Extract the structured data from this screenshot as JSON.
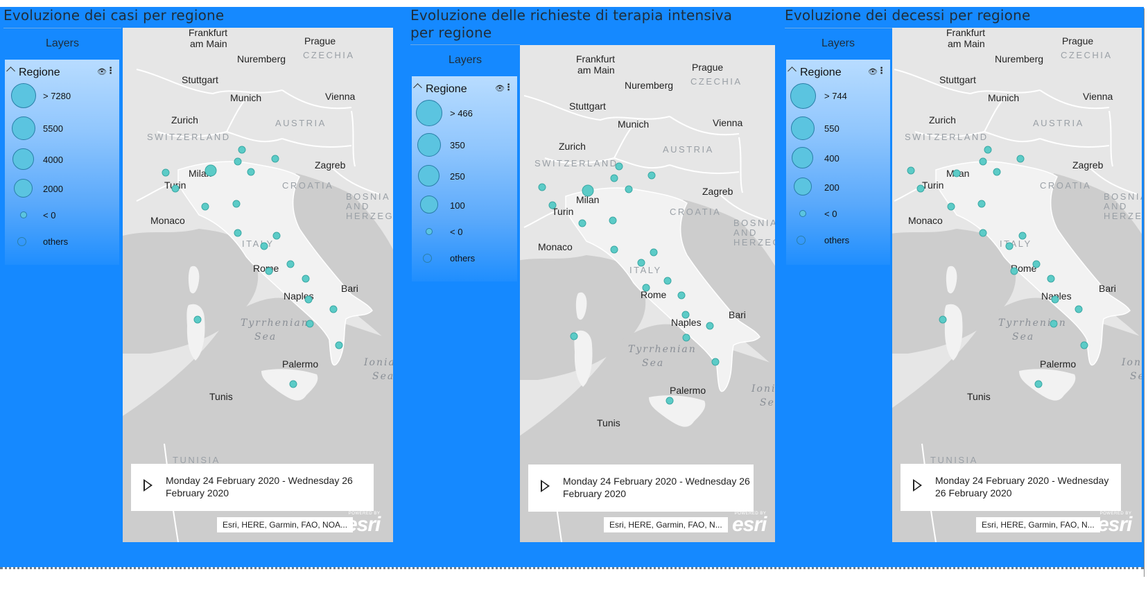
{
  "panels": [
    {
      "title": "Evoluzione dei casi per regione",
      "layers_label": "Layers",
      "legend_title": "Regione",
      "legend_items": [
        {
          "label": "> 7280",
          "marker": "circle-xl"
        },
        {
          "label": "5500",
          "marker": "circle-l"
        },
        {
          "label": "4000",
          "marker": "circle-m"
        },
        {
          "label": "2000",
          "marker": "circle-s"
        },
        {
          "label": "< 0",
          "marker": "circle-xs"
        },
        {
          "label": "others",
          "marker": "circle-hollow"
        }
      ],
      "time_range": "Monday 24 February 2020 - Wednesday 26 February 2020",
      "attribution": "Esri, HERE, Garmin, FAO, NOA...",
      "logo_powered": "POWERED BY",
      "logo_text": "esri"
    },
    {
      "title": "Evoluzione delle richieste di terapia intensiva per regione",
      "layers_label": "Layers",
      "legend_title": "Regione",
      "legend_items": [
        {
          "label": "> 466",
          "marker": "circle-xl"
        },
        {
          "label": "350",
          "marker": "circle-l"
        },
        {
          "label": "250",
          "marker": "circle-m"
        },
        {
          "label": "100",
          "marker": "circle-s"
        },
        {
          "label": "< 0",
          "marker": "circle-xs"
        },
        {
          "label": "others",
          "marker": "circle-hollow"
        }
      ],
      "time_range": "Monday 24 February 2020 - Wednesday 26 February 2020",
      "attribution": "Esri, HERE, Garmin, FAO, N...",
      "logo_powered": "POWERED BY",
      "logo_text": "esri"
    },
    {
      "title": "Evoluzione dei decessi per regione",
      "layers_label": "Layers",
      "legend_title": "Regione",
      "legend_items": [
        {
          "label": "> 744",
          "marker": "circle-xl"
        },
        {
          "label": "550",
          "marker": "circle-l"
        },
        {
          "label": "400",
          "marker": "circle-m"
        },
        {
          "label": "200",
          "marker": "circle-s"
        },
        {
          "label": "< 0",
          "marker": "circle-xs"
        },
        {
          "label": "others",
          "marker": "circle-hollow"
        }
      ],
      "time_range": "Monday 24 February 2020 - Wednesday 26 February 2020",
      "attribution": "Esri, HERE, Garmin, FAO, N...",
      "logo_powered": "POWERED BY",
      "logo_text": "esri"
    }
  ],
  "map_labels": {
    "cities": [
      "Frankfurt am Main",
      "Prague",
      "Nuremberg",
      "Stuttgart",
      "Munich",
      "Vienna",
      "Zurich",
      "Milan",
      "Turin",
      "Zagreb",
      "Monaco",
      "Rome",
      "Naples",
      "Bari",
      "Palermo",
      "Tunis"
    ],
    "countries": [
      "CZECHIA",
      "AUSTRIA",
      "SWITZERLAND",
      "CROATIA",
      "BOSNIA AND HERZEGOVINA",
      "ITALY",
      "TUNISIA"
    ],
    "seas": [
      "Tyrrhenian Sea",
      "Ionian Sea"
    ]
  },
  "colors": {
    "dashboard_bg": "#1589ff",
    "bubble_fill": "#5ccbc7",
    "legend_bubble": "#5bc4e0",
    "map_land": "#e6e6e6",
    "map_sea": "#cdcdcd"
  }
}
